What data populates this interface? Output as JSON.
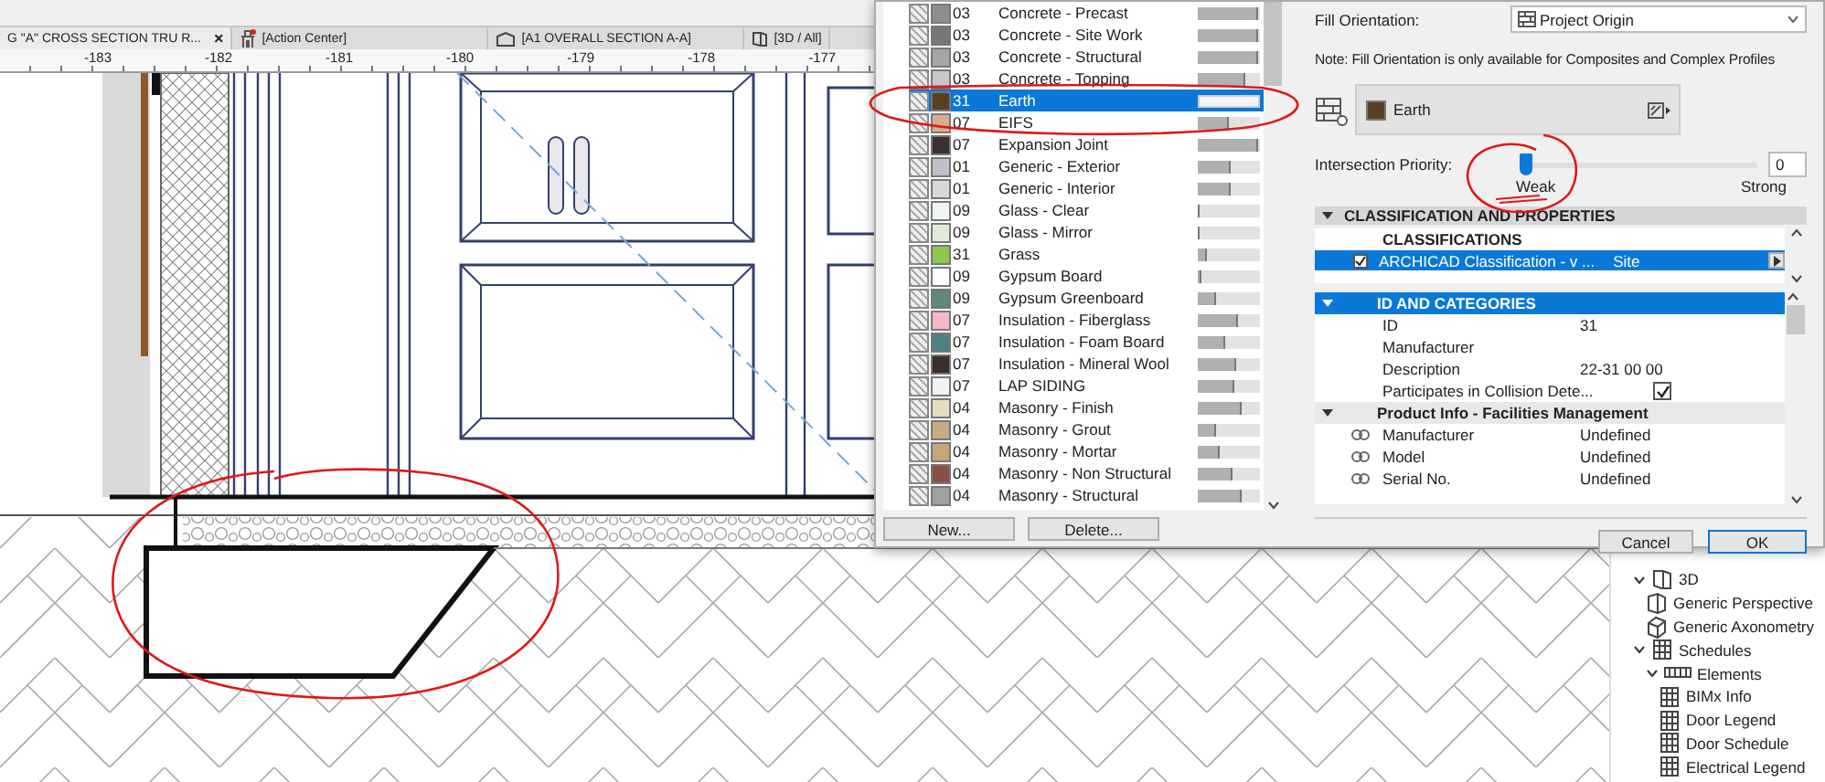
{
  "tabs": [
    {
      "label": "G \"A\" CROSS SECTION TRU R...",
      "kind": "plain",
      "selected": true,
      "close": "×"
    },
    {
      "label": "[Action Center]",
      "kind": "action-center",
      "selected": false
    },
    {
      "label": "[A1 OVERALL SECTION A-A]",
      "kind": "section",
      "selected": false
    },
    {
      "label": "[3D / All]",
      "kind": "view3d",
      "selected": false
    }
  ],
  "ruler": [
    "-183",
    "-182",
    "-181",
    "-180",
    "-179",
    "-178",
    "-177"
  ],
  "dialog": {
    "materials": [
      {
        "code": "03",
        "name": "Concrete - Precast",
        "color": "#8e8e8e",
        "level": 0.98,
        "selected": false
      },
      {
        "code": "03",
        "name": "Concrete - Site Work",
        "color": "#777777",
        "level": 0.97,
        "selected": false
      },
      {
        "code": "03",
        "name": "Concrete - Structural",
        "color": "#a6a6a6",
        "level": 0.98,
        "selected": false
      },
      {
        "code": "03",
        "name": "Concrete - Topping",
        "color": "#c8c8c8",
        "level": 0.77,
        "selected": false
      },
      {
        "code": "31",
        "name": "Earth",
        "color": "#5a3f22",
        "level": 0,
        "selected": true
      },
      {
        "code": "07",
        "name": "EIFS",
        "color": "#d2b08e",
        "level": 0.5,
        "selected": false
      },
      {
        "code": "07",
        "name": "Expansion Joint",
        "color": "#3a3030",
        "level": 0.98,
        "selected": false
      },
      {
        "code": "01",
        "name": "Generic - Exterior",
        "color": "#c0c0c8",
        "level": 0.53,
        "selected": false
      },
      {
        "code": "01",
        "name": "Generic - Interior",
        "color": "#d8d8d8",
        "level": 0.53,
        "selected": false
      },
      {
        "code": "09",
        "name": "Glass - Clear",
        "color": "#eef6f0",
        "level": 0.03,
        "selected": false
      },
      {
        "code": "09",
        "name": "Glass - Mirror",
        "color": "#e0ecd8",
        "level": 0.03,
        "selected": false
      },
      {
        "code": "31",
        "name": "Grass",
        "color": "#8cc850",
        "level": 0.15,
        "selected": false
      },
      {
        "code": "09",
        "name": "Gypsum Board",
        "color": "#ffffff",
        "level": 0.05,
        "selected": false
      },
      {
        "code": "09",
        "name": "Gypsum Greenboard",
        "color": "#5e8a7a",
        "level": 0.3,
        "selected": false
      },
      {
        "code": "07",
        "name": "Insulation - Fiberglass",
        "color": "#f4b8c8",
        "level": 0.65,
        "selected": false
      },
      {
        "code": "07",
        "name": "Insulation - Foam Board",
        "color": "#4e8088",
        "level": 0.44,
        "selected": false
      },
      {
        "code": "07",
        "name": "Insulation - Mineral Wool",
        "color": "#3a2e28",
        "level": 0.62,
        "selected": false
      },
      {
        "code": "07",
        "name": "LAP SIDING",
        "color": "#f2f2f2",
        "level": 0.6,
        "selected": false
      },
      {
        "code": "04",
        "name": "Masonry - Finish",
        "color": "#e8dcc0",
        "level": 0.72,
        "selected": false
      },
      {
        "code": "04",
        "name": "Masonry - Grout",
        "color": "#c8aa80",
        "level": 0.3,
        "selected": false
      },
      {
        "code": "04",
        "name": "Masonry - Mortar",
        "color": "#c4a67c",
        "level": 0.36,
        "selected": false
      },
      {
        "code": "04",
        "name": "Masonry - Non Structural",
        "color": "#8a5040",
        "level": 0.56,
        "selected": false
      },
      {
        "code": "04",
        "name": "Masonry - Structural",
        "color": "#a0a0a0",
        "level": 0.72,
        "selected": false
      }
    ],
    "list_buttons": [
      "New...",
      "Delete..."
    ],
    "fill_orientation": {
      "label": "Fill Orientation:",
      "value": "Project Origin"
    },
    "note": "Note: Fill Orientation is only available for Composites and Complex Profiles",
    "surface": {
      "name": "Earth",
      "color": "#5a3f22"
    },
    "intersection_priority": {
      "label": "Intersection Priority:",
      "level": 0,
      "value": "0",
      "min_label": "Weak",
      "max_label": "Strong"
    },
    "section": {
      "title": "CLASSIFICATION AND PROPERTIES",
      "expanded": true
    },
    "classifications": {
      "header": "CLASSIFICATIONS",
      "rows": [
        {
          "system": "ARCHICAD Classification - v ...",
          "value": "Site",
          "checked": true,
          "selected": true
        }
      ]
    },
    "property_groups": [
      {
        "title": "ID AND CATEGORIES",
        "selected": true,
        "expanded": true,
        "rows": [
          {
            "kind": "text",
            "label": "ID",
            "value": "31"
          },
          {
            "kind": "text",
            "label": "Manufacturer"
          },
          {
            "kind": "text",
            "label": "Description",
            "value": "22-31 00 00"
          },
          {
            "kind": "checkbox",
            "label": "Participates in Collision Dete...",
            "checked": true
          }
        ]
      },
      {
        "title": "Product Info - Facilities Management",
        "selected": false,
        "expanded": true,
        "rows": [
          {
            "kind": "linked",
            "label": "Manufacturer",
            "value": "Undefined"
          },
          {
            "kind": "linked",
            "label": "Model",
            "value": "Undefined"
          },
          {
            "kind": "linked",
            "label": "Serial No.",
            "value": "Undefined"
          }
        ]
      }
    ],
    "footer_buttons": [
      "Cancel",
      "OK"
    ]
  },
  "navigator": [
    {
      "label": "3D",
      "kind": "view3d",
      "expanded": true,
      "children": [
        {
          "label": "Generic Perspective",
          "kind": "perspective"
        },
        {
          "label": "Generic Axonometry",
          "kind": "axonometry"
        }
      ]
    },
    {
      "label": "Schedules",
      "kind": "schedule",
      "expanded": true,
      "children": [
        {
          "label": "Elements",
          "kind": "elements",
          "expanded": true,
          "children": [
            {
              "label": "BIMx Info",
              "kind": "schedule"
            },
            {
              "label": "Door Legend",
              "kind": "schedule"
            },
            {
              "label": "Door Schedule",
              "kind": "schedule"
            },
            {
              "label": "Electrical Legend",
              "kind": "schedule"
            }
          ]
        }
      ]
    }
  ],
  "annotations": [
    {
      "kind": "ellipse"
    },
    {
      "kind": "ellipse"
    },
    {
      "kind": "circle"
    }
  ]
}
